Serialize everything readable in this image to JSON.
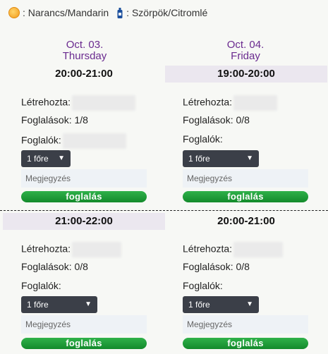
{
  "legend": {
    "orange_label": ": Narancs/Mandarin",
    "syrup_label": ": Szörpök/Citromlé"
  },
  "days": [
    {
      "date": "Oct. 03.",
      "weekday": "Thursday"
    },
    {
      "date": "Oct. 04.",
      "weekday": "Friday"
    }
  ],
  "slots": [
    {
      "time": "20:00-21:00",
      "creator_label": "Létrehozta:",
      "bookings": "Foglalások: 1/8",
      "bookers_label": "Foglalók:",
      "select_value": "1 főre",
      "note_placeholder": "Megjegyzés",
      "button_label": "foglalás"
    },
    {
      "time": "19:00-20:00",
      "creator_label": "Létrehozta:",
      "bookings": "Foglalások: 0/8",
      "bookers_label": "Foglalók:",
      "select_value": "1 főre",
      "note_placeholder": "Megjegyzés",
      "button_label": "foglalás"
    },
    {
      "time": "21:00-22:00",
      "creator_label": "Létrehozta:",
      "bookings": "Foglalások: 0/8",
      "bookers_label": "Foglalók:",
      "select_value": "1 főre",
      "note_placeholder": "Megjegyzés",
      "button_label": "foglalás"
    },
    {
      "time": "20:00-21:00",
      "creator_label": "Létrehozta:",
      "bookings": "Foglalások: 0/8",
      "bookers_label": "Foglalók:",
      "select_value": "1 főre",
      "note_placeholder": "Megjegyzés",
      "button_label": "foglalás"
    }
  ],
  "icons": {
    "orange": "orange-icon",
    "syrup": "bottle-icon",
    "select_chevron": "chevron-down-icon"
  },
  "colors": {
    "day_header": "#6a2a8f",
    "button": "#1f9a36",
    "select_bg": "#3b3f48",
    "shaded_header": "#ebe7ef"
  }
}
